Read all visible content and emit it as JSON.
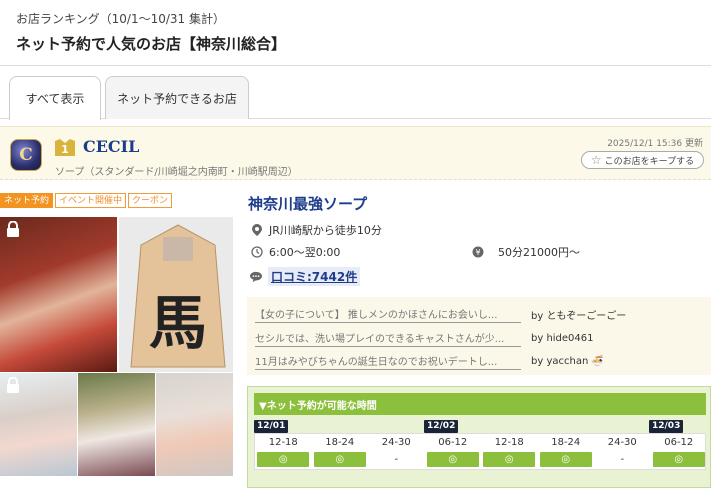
{
  "header": {
    "ranking_label": "お店ランキング（10/1～10/31 集計）",
    "title": "ネット予約で人気のお店【神奈川総合】"
  },
  "tabs": [
    {
      "label": "すべて表示",
      "active": true
    },
    {
      "label": "ネット予約できるお店",
      "active": false
    }
  ],
  "shop": {
    "rank": "1",
    "name": "CECIL",
    "category": "ソープ（スタンダード/川崎堀之内南町・川崎駅周辺）",
    "updated": "2025/12/1 15:36 更新",
    "keep_label": "このお店をキープする",
    "tags": [
      "ネット予約",
      "イベント開催中",
      "クーポン"
    ],
    "catchcopy": "神奈川最強ソープ",
    "access": "JR川崎駅から徒歩10分",
    "hours": "6:00～翌0:00",
    "price": "50分21000円～",
    "review_link": "口コミ:7442件",
    "shogi_text": "馬"
  },
  "reviews": [
    {
      "text": "【女の子について】 推しメンのかほさんにお会いし...",
      "by": "by ともぞーごーごー"
    },
    {
      "text": "セシルでは、洗い場プレイのできるキャストさんが少...",
      "by": "by hide0461"
    },
    {
      "text": "11月はみやびちゃんの誕生日なのでお祝いデートし...",
      "by": "by yacchan"
    }
  ],
  "booking": {
    "heading": "▼ネット予約が可能な時間",
    "dates": [
      "12/01",
      "12/02",
      "12/03"
    ],
    "slots": [
      {
        "time": "12-18",
        "status": "◎"
      },
      {
        "time": "18-24",
        "status": "◎"
      },
      {
        "time": "24-30",
        "status": "-"
      },
      {
        "time": "06-12",
        "status": "◎"
      },
      {
        "time": "12-18",
        "status": "◎"
      },
      {
        "time": "18-24",
        "status": "◎"
      },
      {
        "time": "24-30",
        "status": "-"
      },
      {
        "time": "06-12",
        "status": "◎"
      }
    ]
  },
  "colors": {
    "accent_blue": "#1e3c8c",
    "tag_orange": "#f39422",
    "booking_green": "#8cc03c"
  }
}
